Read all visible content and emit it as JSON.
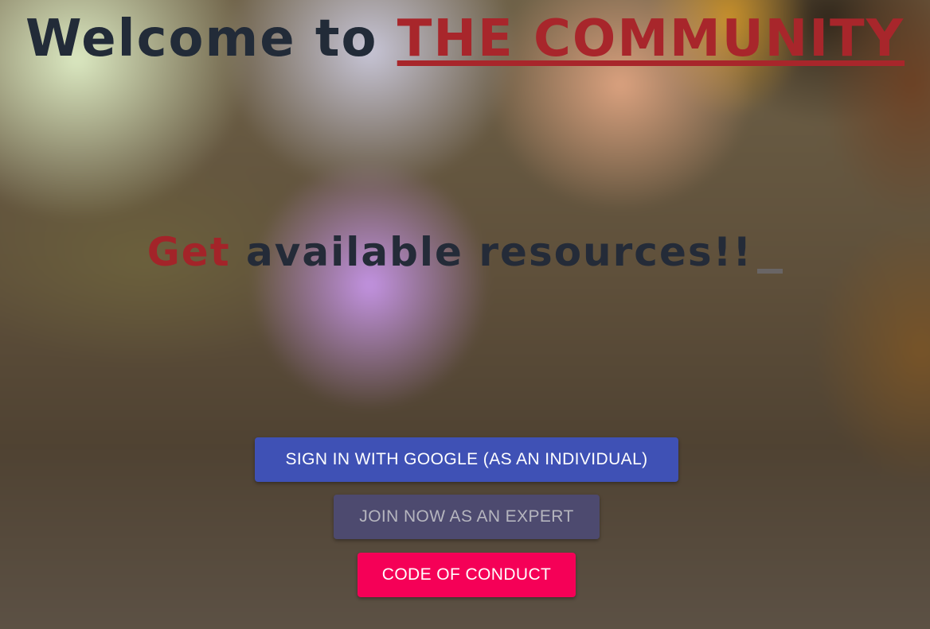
{
  "hero": {
    "headline_prefix": "Welcome to ",
    "headline_highlight": "THE COMMUNITY",
    "typing_accent": "Get",
    "typing_rest": " available resources!!"
  },
  "actions": {
    "google_signin_label": "SIGN IN WITH GOOGLE (AS AN INDIVIDUAL)",
    "expert_join_label": "JOIN NOW AS AN EXPERT",
    "code_of_conduct_label": "CODE OF CONDUCT"
  },
  "colors": {
    "heading_text": "#222b38",
    "accent_red": "#a8262b",
    "google_button": "#3f51b5",
    "expert_button": "#4b4b82",
    "conduct_button": "#f50057"
  }
}
